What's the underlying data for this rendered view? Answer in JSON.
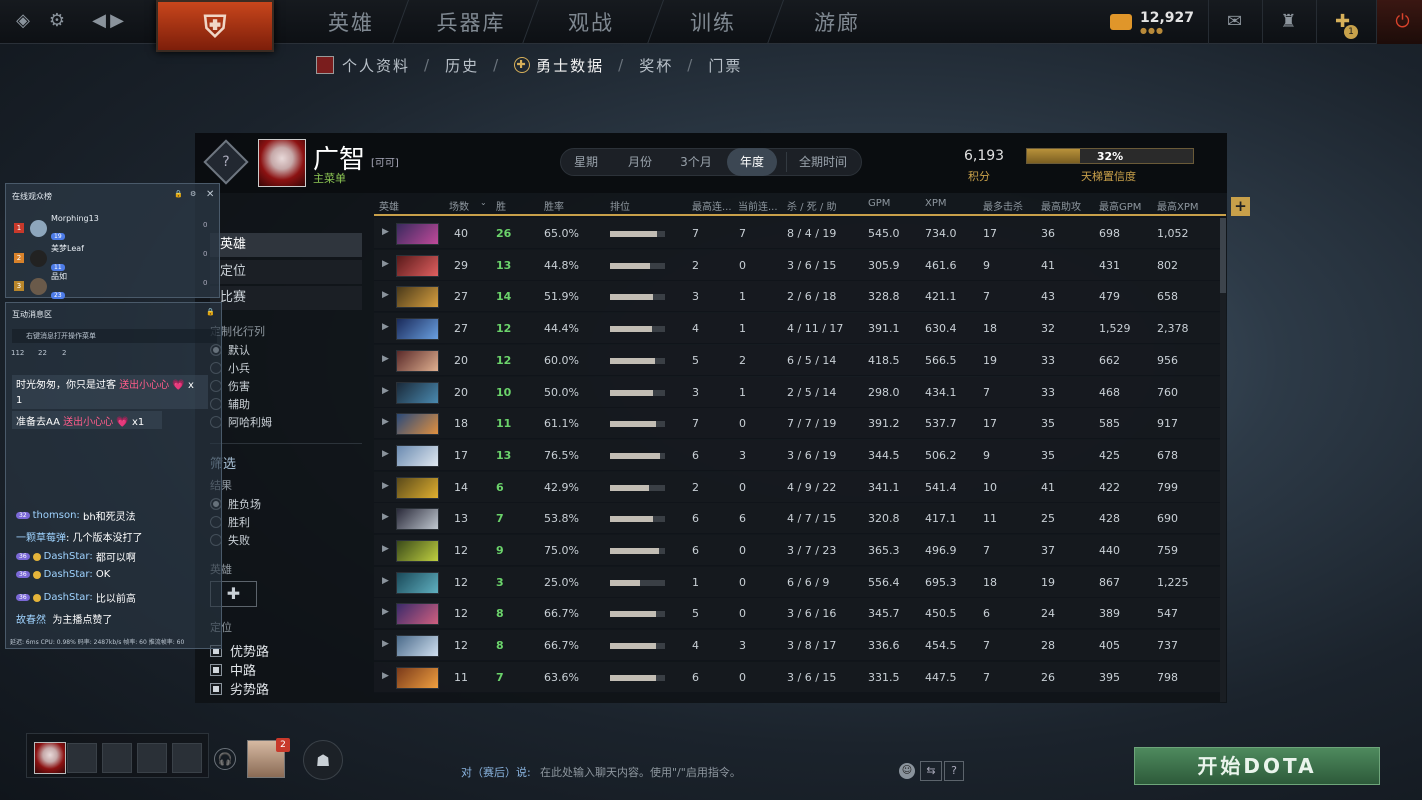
{
  "topnav": {
    "items": [
      "英雄",
      "兵器库",
      "观战",
      "训练",
      "游廊"
    ],
    "coins": "12,927",
    "coins_sub": "●●●",
    "quest_badge": "1"
  },
  "subnav": {
    "profile": "个人资料",
    "history": "历史",
    "stats": "勇士数据",
    "trophies": "奖杯",
    "tickets": "门票",
    "sep": "/"
  },
  "player": {
    "name": "广智",
    "tag": "[可可]",
    "main": "主菜单",
    "points": "6,193",
    "points_label": "积分",
    "confidence_pct": "32%",
    "confidence_value": 0.32,
    "confidence_label": "天梯置信度"
  },
  "periods": [
    "星期",
    "月份",
    "3个月",
    "年度",
    "全期时间"
  ],
  "filters": {
    "tabs": [
      "英雄",
      "定位",
      "比赛"
    ],
    "custom_label": "定制化行列",
    "custom_options": [
      "默认",
      "小兵",
      "伤害",
      "辅助",
      "阿哈利姆"
    ],
    "filter_title": "筛选",
    "result_label": "结果",
    "result_options": [
      "胜负场",
      "胜利",
      "失败"
    ],
    "hero_label": "英雄",
    "hero_add": "✚",
    "role_label": "定位",
    "role_options": [
      "优势路",
      "中路",
      "劣势路"
    ]
  },
  "table": {
    "headers": [
      "英雄",
      "场数",
      "胜",
      "胜率",
      "排位",
      "最高连...",
      "当前连...",
      "杀 / 死 / 助",
      "GPM",
      "XPM",
      "最多击杀",
      "最高助攻",
      "最高GPM",
      "最高XPM"
    ],
    "rows": [
      {
        "games": "40",
        "wins": "26",
        "winrate": "65.0%",
        "rank": 0.85,
        "maxstreak": "7",
        "curstreak": "7",
        "kda": "8 / 4 / 19",
        "gpm": "545.0",
        "xpm": "734.0",
        "maxk": "17",
        "maxa": "36",
        "maxgpm": "698",
        "maxxpm": "1,052",
        "c1": "#3a2a5e",
        "c2": "#c04a9a"
      },
      {
        "games": "29",
        "wins": "13",
        "winrate": "44.8%",
        "rank": 0.72,
        "maxstreak": "2",
        "curstreak": "0",
        "kda": "3 / 6 / 15",
        "gpm": "305.9",
        "xpm": "461.6",
        "maxk": "9",
        "maxa": "41",
        "maxgpm": "431",
        "maxxpm": "802",
        "c1": "#5a1a1a",
        "c2": "#e06060"
      },
      {
        "games": "27",
        "wins": "14",
        "winrate": "51.9%",
        "rank": 0.78,
        "maxstreak": "3",
        "curstreak": "1",
        "kda": "2 / 6 / 18",
        "gpm": "328.8",
        "xpm": "421.1",
        "maxk": "7",
        "maxa": "43",
        "maxgpm": "479",
        "maxxpm": "658",
        "c1": "#4a3a1a",
        "c2": "#d8a040"
      },
      {
        "games": "27",
        "wins": "12",
        "winrate": "44.4%",
        "rank": 0.76,
        "maxstreak": "4",
        "curstreak": "1",
        "kda": "4 / 11 / 17",
        "gpm": "391.1",
        "xpm": "630.4",
        "maxk": "18",
        "maxa": "32",
        "maxgpm": "1,529",
        "maxxpm": "2,378",
        "c1": "#1a2a5a",
        "c2": "#6aa0e0"
      },
      {
        "games": "20",
        "wins": "12",
        "winrate": "60.0%",
        "rank": 0.82,
        "maxstreak": "5",
        "curstreak": "2",
        "kda": "6 / 5 / 14",
        "gpm": "418.5",
        "xpm": "566.5",
        "maxk": "19",
        "maxa": "33",
        "maxgpm": "662",
        "maxxpm": "956",
        "c1": "#5a2a2a",
        "c2": "#e0b090"
      },
      {
        "games": "20",
        "wins": "10",
        "winrate": "50.0%",
        "rank": 0.78,
        "maxstreak": "3",
        "curstreak": "1",
        "kda": "2 / 5 / 14",
        "gpm": "298.0",
        "xpm": "434.1",
        "maxk": "7",
        "maxa": "33",
        "maxgpm": "468",
        "maxxpm": "760",
        "c1": "#1a2a3a",
        "c2": "#4a8ab0"
      },
      {
        "games": "18",
        "wins": "11",
        "winrate": "61.1%",
        "rank": 0.83,
        "maxstreak": "7",
        "curstreak": "0",
        "kda": "7 / 7 / 19",
        "gpm": "391.2",
        "xpm": "537.7",
        "maxk": "17",
        "maxa": "35",
        "maxgpm": "585",
        "maxxpm": "917",
        "c1": "#2a4a7a",
        "c2": "#e09040"
      },
      {
        "games": "17",
        "wins": "13",
        "winrate": "76.5%",
        "rank": 0.9,
        "maxstreak": "6",
        "curstreak": "3",
        "kda": "3 / 6 / 19",
        "gpm": "344.5",
        "xpm": "506.2",
        "maxk": "9",
        "maxa": "35",
        "maxgpm": "425",
        "maxxpm": "678",
        "c1": "#6a8ab0",
        "c2": "#e0e8f0"
      },
      {
        "games": "14",
        "wins": "6",
        "winrate": "42.9%",
        "rank": 0.7,
        "maxstreak": "2",
        "curstreak": "0",
        "kda": "4 / 9 / 22",
        "gpm": "341.1",
        "xpm": "541.4",
        "maxk": "10",
        "maxa": "41",
        "maxgpm": "422",
        "maxxpm": "799",
        "c1": "#5a4a1a",
        "c2": "#e0b030"
      },
      {
        "games": "13",
        "wins": "7",
        "winrate": "53.8%",
        "rank": 0.79,
        "maxstreak": "6",
        "curstreak": "6",
        "kda": "4 / 7 / 15",
        "gpm": "320.8",
        "xpm": "417.1",
        "maxk": "11",
        "maxa": "25",
        "maxgpm": "428",
        "maxxpm": "690",
        "c1": "#2a2a3a",
        "c2": "#c0c8d0"
      },
      {
        "games": "12",
        "wins": "9",
        "winrate": "75.0%",
        "rank": 0.89,
        "maxstreak": "6",
        "curstreak": "0",
        "kda": "3 / 7 / 23",
        "gpm": "365.3",
        "xpm": "496.9",
        "maxk": "7",
        "maxa": "37",
        "maxgpm": "440",
        "maxxpm": "759",
        "c1": "#3a4a1a",
        "c2": "#c0d040"
      },
      {
        "games": "12",
        "wins": "3",
        "winrate": "25.0%",
        "rank": 0.55,
        "maxstreak": "1",
        "curstreak": "0",
        "kda": "6 / 6 / 9",
        "gpm": "556.4",
        "xpm": "695.3",
        "maxk": "18",
        "maxa": "19",
        "maxgpm": "867",
        "maxxpm": "1,225",
        "c1": "#1a4a5a",
        "c2": "#60b0c0"
      },
      {
        "games": "12",
        "wins": "8",
        "winrate": "66.7%",
        "rank": 0.84,
        "maxstreak": "5",
        "curstreak": "0",
        "kda": "3 / 6 / 16",
        "gpm": "345.7",
        "xpm": "450.5",
        "maxk": "6",
        "maxa": "24",
        "maxgpm": "389",
        "maxxpm": "547",
        "c1": "#3a2a6a",
        "c2": "#d06080"
      },
      {
        "games": "12",
        "wins": "8",
        "winrate": "66.7%",
        "rank": 0.84,
        "maxstreak": "4",
        "curstreak": "3",
        "kda": "3 / 8 / 17",
        "gpm": "336.6",
        "xpm": "454.5",
        "maxk": "7",
        "maxa": "28",
        "maxgpm": "405",
        "maxxpm": "737",
        "c1": "#4a6a8a",
        "c2": "#d0e0f0"
      },
      {
        "games": "11",
        "wins": "7",
        "winrate": "63.6%",
        "rank": 0.83,
        "maxstreak": "6",
        "curstreak": "0",
        "kda": "3 / 6 / 15",
        "gpm": "331.5",
        "xpm": "447.5",
        "maxk": "7",
        "maxa": "26",
        "maxgpm": "395",
        "maxxpm": "798",
        "c1": "#7a3a1a",
        "c2": "#f0a040"
      }
    ]
  },
  "overlay": {
    "viewers_title": "在线观众榜",
    "viewers": [
      {
        "rank": "1",
        "name": "Morphing13",
        "badge": "19"
      },
      {
        "rank": "2",
        "name": "美梦Leaf",
        "badge": "11"
      },
      {
        "rank": "3",
        "name": "品如",
        "badge": "23"
      }
    ],
    "interact_title": "互动消息区",
    "hint": "右键消息打开操作菜单",
    "stats": [
      "112",
      "22",
      "2"
    ],
    "gift1_text": "时光匆匆，你只是过客",
    "gift1_gift": "送出小心心",
    "gift1_count": "x",
    "gift1_more": "1",
    "gift2_text": "准备去AA",
    "gift2_gift": "送出小心心",
    "gift2_count": "x1",
    "messages": [
      {
        "lvl": "32",
        "name": "thomson:",
        "text": "bh和死灵法"
      },
      {
        "lvl": "",
        "name": "一颗草莓弹",
        "text": ": 几个版本没打了"
      },
      {
        "lvl": "36",
        "name": "DashStar:",
        "text": "都可以啊"
      },
      {
        "lvl": "36",
        "name": "DashStar:",
        "text": "OK"
      },
      {
        "lvl": "36",
        "name": "DashStar:",
        "text": "比以前高"
      }
    ],
    "last_name": "故春然",
    "last_text": "为主播点赞了",
    "status": "延迟: 6ms  CPU: 0.98%  码率: 2487kb/s  帧率: 60  推流帧率: 60"
  },
  "bottom": {
    "friend_badge": "2",
    "chat_label": "对（赛后）说:",
    "chat_placeholder": "在此处输入聊天内容。使用\"/\"启用指令。",
    "play": "开始DOTA"
  },
  "colors": {
    "accent": "#c8a04a",
    "win": "#6bd36b",
    "play": "#3f7a50"
  }
}
